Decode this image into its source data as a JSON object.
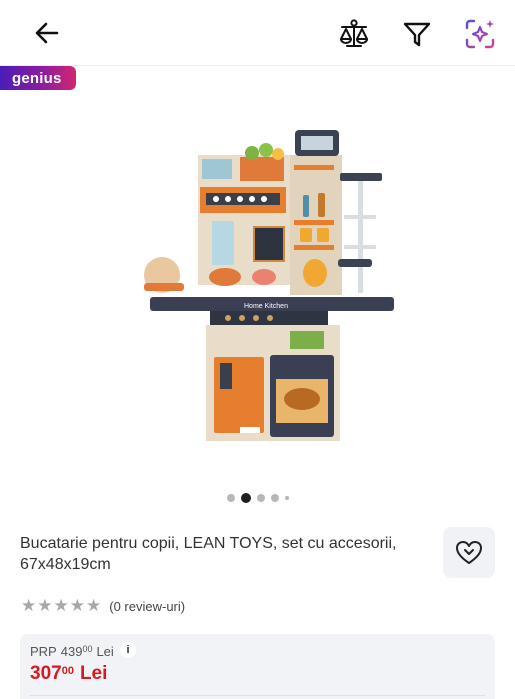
{
  "header": {
    "back_icon": "arrow-left-icon",
    "compare_icon": "compare-scale-icon",
    "filter_icon": "filter-icon",
    "ai_icon": "ai-sparkle-icon"
  },
  "badge": {
    "label": "genius"
  },
  "gallery": {
    "image_description_icon": "play-kitchen-product-image",
    "current_index": 2,
    "dot_count": 5
  },
  "product": {
    "title": "Bucatarie pentru copii, LEAN TOYS, set cu accesorii, 67x48x19cm",
    "kitchen_sign": "Home Kitchen",
    "rating": {
      "stars": 0,
      "max": 5,
      "reviews_text": "(0 review-uri)"
    },
    "favorite_icon": "heart-icon"
  },
  "price": {
    "prp_label": "PRP",
    "prp_int": "439",
    "prp_dec": "00",
    "prp_currency": "Lei",
    "info_label": "i",
    "current_int": "307",
    "current_dec": "00",
    "current_currency": "Lei"
  },
  "colors": {
    "accent_price": "#d71920",
    "genius_gradient_start": "#4b1cb8",
    "genius_gradient_end": "#d2266f",
    "ai_icon_start": "#5a4de0",
    "ai_icon_end": "#d23e9a"
  }
}
